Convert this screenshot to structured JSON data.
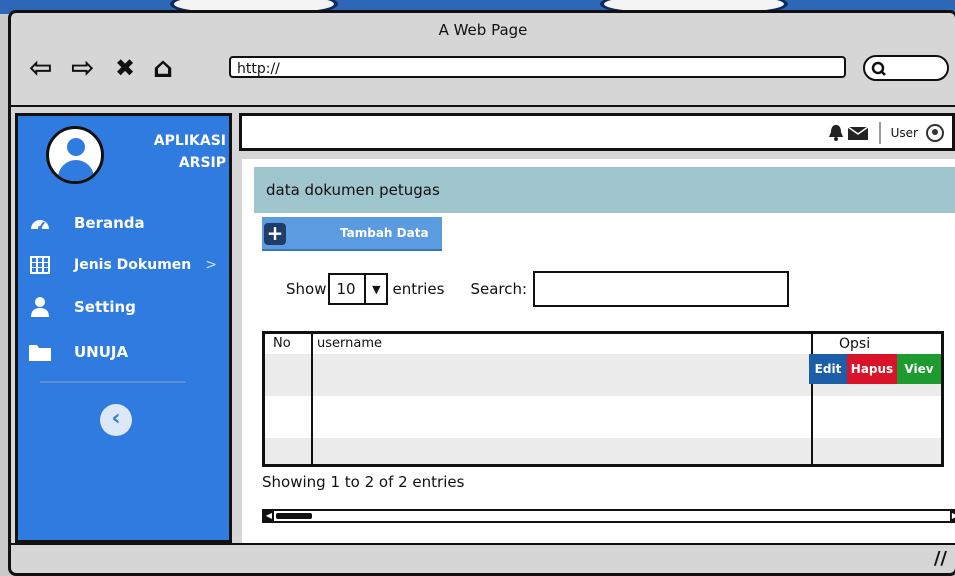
{
  "window": {
    "title": "A Web Page"
  },
  "browser": {
    "back_icon": "⇦",
    "forward_icon": "⇨",
    "close_icon": "✖",
    "home_icon": "⌂",
    "address": "http://"
  },
  "sidebar": {
    "brand_line1": "APLIKASI",
    "brand_line2": "ARSIP",
    "items": [
      {
        "label": "Beranda",
        "icon": "dashboard-icon",
        "has_arrow": false
      },
      {
        "label": "Jenis Dokumen",
        "icon": "grid-icon",
        "has_arrow": true,
        "arrow": ">"
      },
      {
        "label": "Setting",
        "icon": "user-icon",
        "has_arrow": false
      },
      {
        "label": "UNUJA",
        "icon": "folder-icon",
        "has_arrow": false
      }
    ]
  },
  "topbar": {
    "user_label": "User"
  },
  "content": {
    "panel_title": "data dokumen petugas",
    "add_button": "Tambah Data",
    "show_label": "Show",
    "entries_value": "10",
    "entries_label": "entries",
    "search_label": "Search:",
    "table": {
      "headers": [
        "No",
        "username",
        "Opsi"
      ],
      "actions": {
        "edit": "Edit",
        "hapus": "Hapus",
        "view": "Viev"
      }
    },
    "info": "Showing 1 to 2 of 2 entries"
  },
  "colors": {
    "sidebar_bg": "#2f7be0",
    "panel_head": "#9fc6cc",
    "edit": "#1c5ea8",
    "hapus": "#d9142a",
    "view": "#1e9b2f"
  }
}
